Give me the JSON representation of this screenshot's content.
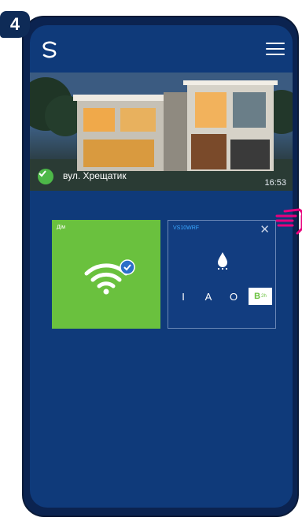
{
  "step": "4",
  "header": {
    "logo_icon": "salus-logo-icon",
    "menu_icon": "hamburger-menu-icon"
  },
  "location": {
    "address": "вул. Хрещатик",
    "time": "16:53",
    "status_icon": "check-circle-icon"
  },
  "tiles": [
    {
      "label": "Дім",
      "icon": "wifi-icon",
      "badge_icon": "check-badge-icon",
      "color": "#6ac13e"
    },
    {
      "label": "VS10WRF",
      "icon": "water-drop-icon",
      "close_icon": "close-icon",
      "modes": [
        "I",
        "A",
        "O",
        "B"
      ],
      "active_mode_suffix": "2h",
      "color": "#123d80"
    }
  ],
  "colors": {
    "screen_bg": "#0f3a7a",
    "phone_frame": "#0b2350",
    "accent_pink": "#e8007d",
    "accent_green": "#6ac13e"
  }
}
